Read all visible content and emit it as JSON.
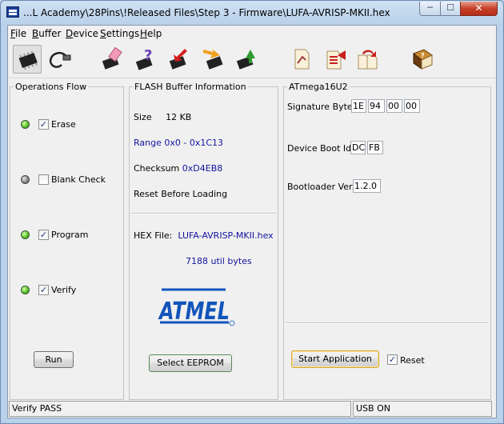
{
  "window": {
    "title": "...L Academy\\28Pins\\!Released Files\\Step 3 - Firmware\\LUFA-AVRISP-MKII.hex"
  },
  "menu": [
    {
      "key": "F",
      "rest": "ile"
    },
    {
      "key": "B",
      "rest": "uffer"
    },
    {
      "key": "D",
      "rest": "evice"
    },
    {
      "key": "S",
      "rest": "ettings"
    },
    {
      "key": "H",
      "rest": "elp"
    }
  ],
  "toolbar_icons": [
    "chip-select-icon",
    "usb-connect-icon",
    "erase-chip-icon",
    "blank-check-icon",
    "program-chip-icon",
    "read-chip-icon",
    "verify-chip-icon",
    "load-hex-icon",
    "save-hex-icon",
    "reload-hex-icon",
    "help-book-icon"
  ],
  "ops": {
    "title": "Operations Flow",
    "erase_label": "Erase",
    "blank_label": "Blank Check",
    "program_label": "Program",
    "verify_label": "Verify",
    "run_label": "Run",
    "led_colors": {
      "on": "#5cc424",
      "off": "#8a8a8a"
    }
  },
  "flash": {
    "title": "FLASH Buffer Information",
    "size_label": "Size",
    "size_value": "12 KB",
    "range_label": "Range",
    "range_value": "0x0 - 0x1C13",
    "checksum_label": "Checksum",
    "checksum_value": "0xD4EB8",
    "reset_label": "Reset Before Loading",
    "hex_label": "HEX File:",
    "hex_value": "LUFA-AVRISP-MKII.hex",
    "bytes_value": "7188 util bytes",
    "logo_text": "ATMEL",
    "eeprom_label": "Select EEPROM"
  },
  "device": {
    "title": "ATmega16U2",
    "sig_label": "Signature Bytes",
    "sig": [
      "1E",
      "94",
      "00",
      "00"
    ],
    "boot_label": "Device Boot Ids",
    "boot": [
      "DC",
      "FB"
    ],
    "bl_label": "Bootloader Ver.",
    "bl_value": "1.2.0",
    "start_label": "Start Application",
    "reset_label": "Reset"
  },
  "status": {
    "left": "Verify PASS",
    "right": "USB ON"
  },
  "colors": {
    "accent_blue": "#1414a0",
    "atmel_blue": "#1155bb"
  }
}
